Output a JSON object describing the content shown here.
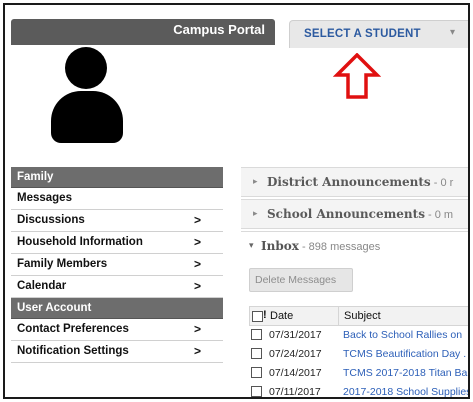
{
  "header": {
    "portal_title": "Campus Portal",
    "student_select_label": "SELECT A STUDENT",
    "student_select_caret": "▾"
  },
  "annotation": {
    "arrow_color": "#e01010"
  },
  "sidebar": {
    "sections": [
      {
        "header": "Family",
        "items": [
          {
            "label": "Messages",
            "chevron": "",
            "active": true
          },
          {
            "label": "Discussions",
            "chevron": ">"
          },
          {
            "label": "Household Information",
            "chevron": ">"
          },
          {
            "label": "Family Members",
            "chevron": ">"
          },
          {
            "label": "Calendar",
            "chevron": ">"
          }
        ]
      },
      {
        "header": "User Account",
        "items": [
          {
            "label": "Contact Preferences",
            "chevron": ">"
          },
          {
            "label": "Notification Settings",
            "chevron": ">"
          }
        ]
      }
    ]
  },
  "main": {
    "district_announcements": {
      "caret": "▸",
      "title": "District Announcements",
      "count": " - 0 r"
    },
    "school_announcements": {
      "caret": "▸",
      "title": "School Announcements",
      "count": " - 0 m"
    },
    "inbox": {
      "caret": "▾",
      "title": "Inbox",
      "count": " - 898 messages",
      "delete_label": "Delete Messages",
      "columns": {
        "flag": "!",
        "date": "Date",
        "subject": "Subject"
      },
      "messages": [
        {
          "date": "07/31/2017",
          "subject": "Back to School Rallies on"
        },
        {
          "date": "07/24/2017",
          "subject": "TCMS Beautification Day ."
        },
        {
          "date": "07/14/2017",
          "subject": "TCMS 2017-2018 Titan Ba"
        },
        {
          "date": "07/11/2017",
          "subject": "2017-2018 School Supplies"
        }
      ]
    }
  }
}
